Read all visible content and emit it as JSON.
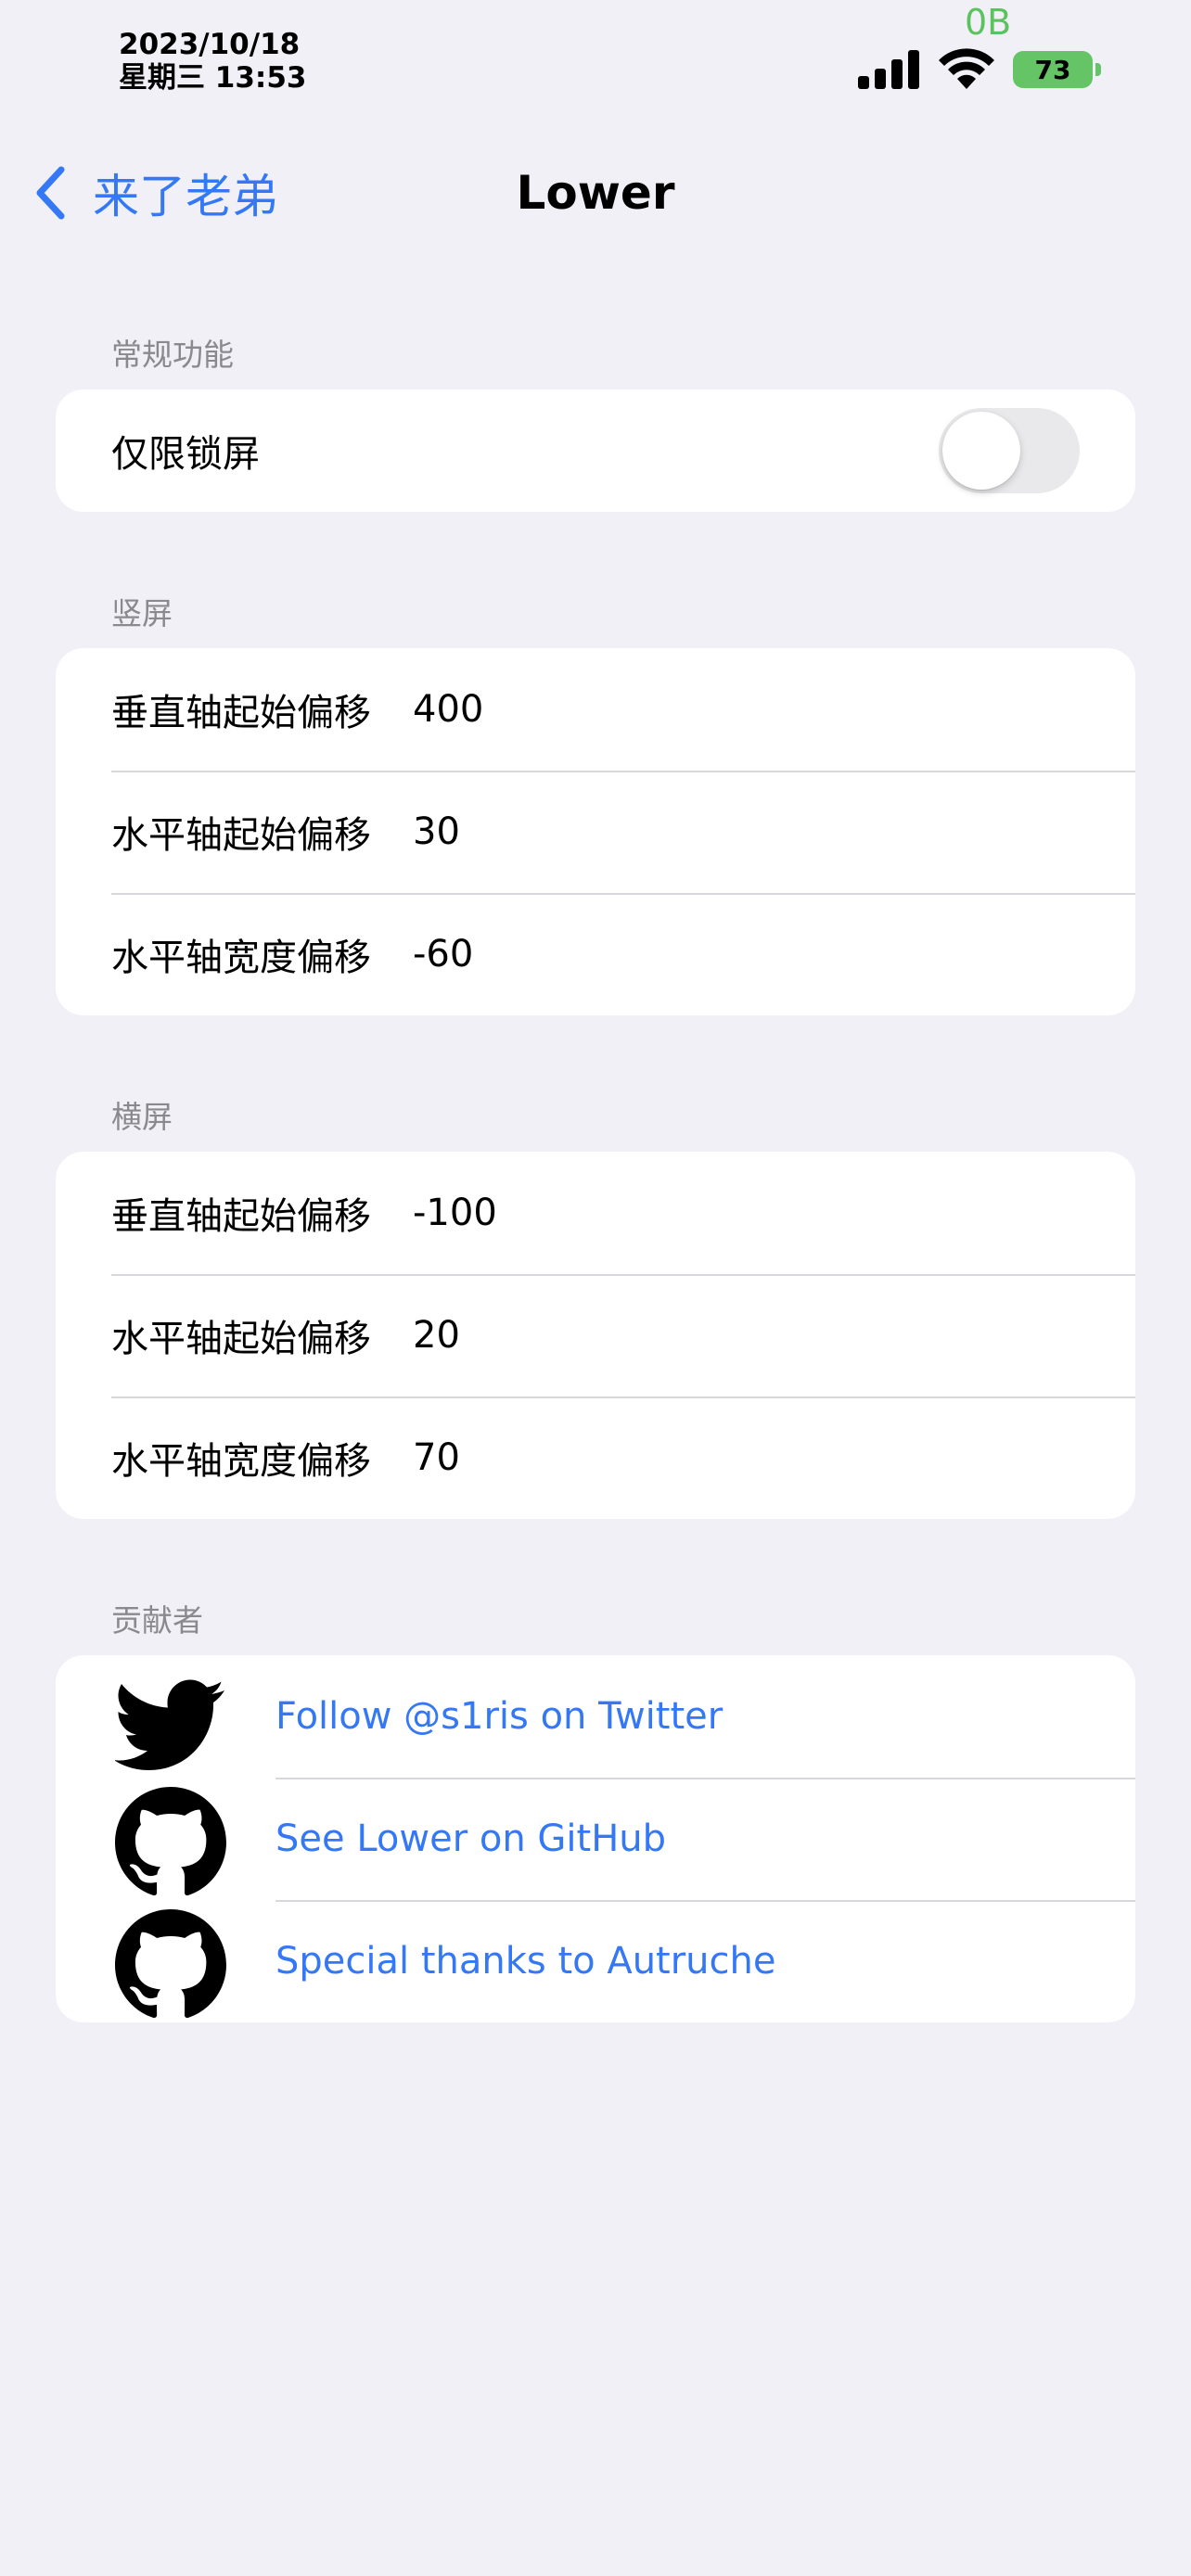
{
  "status_bar": {
    "date": "2023/10/18",
    "weekday_time": "星期三 13:53",
    "network_speed": "0B",
    "battery_level": "73",
    "battery_color": "#65c466"
  },
  "nav": {
    "back_label": "来了老弟",
    "title": "Lower",
    "accent_color": "#3478f6"
  },
  "general": {
    "header": "常规功能",
    "lock_screen_only_label": "仅限锁屏",
    "lock_screen_only_enabled": false
  },
  "portrait": {
    "header": "竖屏",
    "rows": [
      {
        "label": "垂直轴起始偏移",
        "value": "400"
      },
      {
        "label": "水平轴起始偏移",
        "value": "30"
      },
      {
        "label": "水平轴宽度偏移",
        "value": "-60"
      }
    ]
  },
  "landscape": {
    "header": "横屏",
    "rows": [
      {
        "label": "垂直轴起始偏移",
        "value": "-100"
      },
      {
        "label": "水平轴起始偏移",
        "value": "20"
      },
      {
        "label": "水平轴宽度偏移",
        "value": "70"
      }
    ]
  },
  "contributors": {
    "header": "贡献者",
    "items": [
      {
        "icon": "twitter-icon",
        "label": "Follow @s1ris on Twitter"
      },
      {
        "icon": "github-icon",
        "label": "See Lower on GitHub"
      },
      {
        "icon": "github-icon",
        "label": "Special thanks to Autruche"
      }
    ]
  }
}
